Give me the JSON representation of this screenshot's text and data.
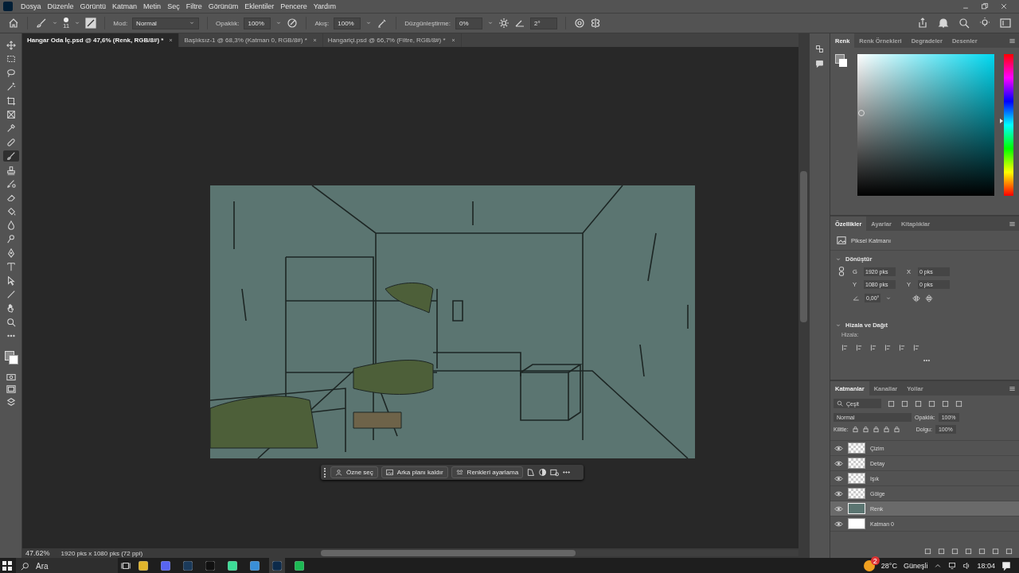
{
  "menu": [
    "Dosya",
    "Düzenle",
    "Görüntü",
    "Katman",
    "Metin",
    "Seç",
    "Filtre",
    "Görünüm",
    "Eklentiler",
    "Pencere",
    "Yardım"
  ],
  "options_bar": {
    "brush_size": "11",
    "mode_label": "Mod:",
    "mode": "Normal",
    "opacity_label": "Opaklık:",
    "opacity": "100%",
    "flow_label": "Akış:",
    "flow": "100%",
    "smoothing_label": "Düzgünleştirme:",
    "smoothing": "0%",
    "angle": "2°"
  },
  "document_tabs": [
    {
      "title": "Hangar Oda İç.psd @ 47,6% (Renk, RGB/8#) *",
      "selected": true
    },
    {
      "title": "Başlıksız-1 @ 68,3% (Katman 0, RGB/8#) *",
      "selected": false
    },
    {
      "title": "Hangariçi.psd @ 66,7% (Filtre, RGB/8#) *",
      "selected": false
    }
  ],
  "tools": [
    {
      "selected": false
    },
    {
      "selected": false
    },
    {
      "selected": false
    },
    {
      "selected": false
    },
    {
      "selected": false
    },
    {
      "selected": false
    },
    {
      "selected": false
    },
    {
      "selected": false
    },
    {
      "selected": true
    },
    {
      "selected": false
    },
    {
      "selected": false
    },
    {
      "selected": false
    },
    {
      "selected": false
    },
    {
      "selected": false
    },
    {
      "selected": false
    },
    {
      "selected": false
    },
    {
      "selected": false
    },
    {
      "selected": false
    },
    {
      "selected": false
    },
    {
      "selected": false
    },
    {
      "selected": false
    },
    {
      "selected": false
    }
  ],
  "contextual_bar": {
    "buttons": [
      "Özne seç",
      "Arka planı kaldır",
      "Renkleri ayarlama"
    ]
  },
  "status_bar": {
    "zoom": "47.62%",
    "info": "1920 pks x 1080 pks (72 ppi)"
  },
  "color_panel": {
    "hue": {
      "level": 0.53
    },
    "tabs": [
      {
        "label": "Renk",
        "selected": true
      },
      {
        "label": "Renk Örnekleri",
        "selected": false
      },
      {
        "label": "Degradeler",
        "selected": false
      },
      {
        "label": "Desenler",
        "selected": false
      }
    ]
  },
  "properties_panel": {
    "tabs": [
      {
        "label": "Özellikler",
        "selected": true
      },
      {
        "label": "Ayarlar",
        "selected": false
      },
      {
        "label": "Kitaplıklar",
        "selected": false
      }
    ],
    "layer_type": "Piksel Katmanı",
    "transform_title": "Dönüştür",
    "fields": [
      {
        "label": "G",
        "value": "1920 pks"
      },
      {
        "label": "X",
        "value": "0 pks"
      },
      {
        "label": "Y",
        "value": "1080 pks"
      },
      {
        "label": "Y",
        "value": "0 pks"
      }
    ],
    "angle": "0,00°",
    "align_title": "Hizala ve Dağıt",
    "align_label": "Hizala:"
  },
  "layers_panel": {
    "tabs": [
      {
        "label": "Katmanlar",
        "selected": true
      },
      {
        "label": "Kanallar",
        "selected": false
      },
      {
        "label": "Yollar",
        "selected": false
      }
    ],
    "filter": "Çeşit",
    "blend_mode": "Normal",
    "opacity_label": "Opaklık:",
    "opacity": "100%",
    "lock_label": "Kilitle:",
    "fill_label": "Dolgu:",
    "fill": "100%",
    "layers": [
      {
        "name": "Çizim",
        "visible": true,
        "selected": false,
        "kind": "transparent"
      },
      {
        "name": "Detay",
        "visible": true,
        "selected": false,
        "kind": "transparent"
      },
      {
        "name": "Işık",
        "visible": true,
        "selected": false,
        "kind": "transparent"
      },
      {
        "name": "Gölge",
        "visible": true,
        "selected": false,
        "kind": "transparent"
      },
      {
        "name": "Renk",
        "visible": true,
        "selected": true,
        "kind": "color"
      },
      {
        "name": "Katman 0",
        "visible": true,
        "selected": false,
        "kind": "white"
      }
    ]
  },
  "taskbar": {
    "search_placeholder": "Ara",
    "apps": [
      {
        "selected": false
      },
      {
        "selected": false
      },
      {
        "selected": false
      },
      {
        "selected": false
      },
      {
        "selected": false
      },
      {
        "selected": false
      },
      {
        "selected": true
      },
      {
        "selected": false
      }
    ],
    "weather_badge": "2",
    "temperature": "28°C",
    "weather": "Güneşli",
    "time": "18:04"
  }
}
